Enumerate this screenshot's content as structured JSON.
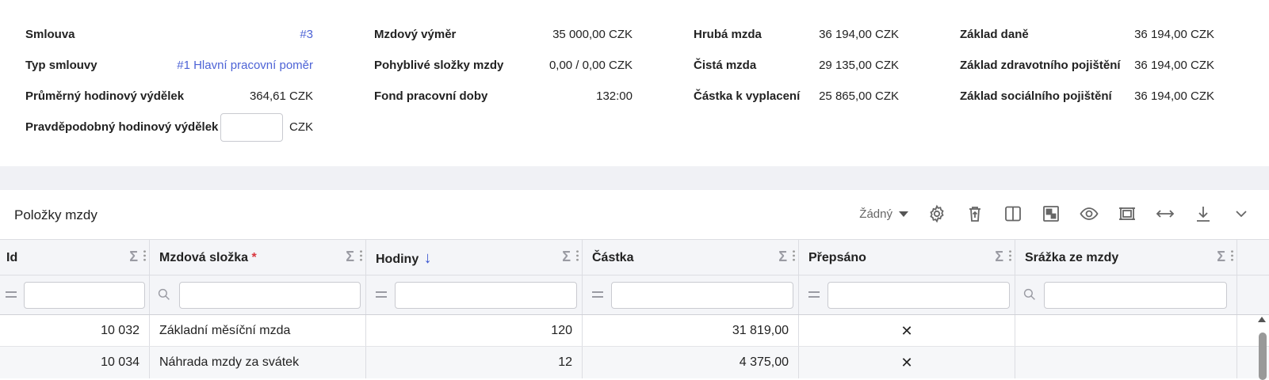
{
  "summary": {
    "col1": [
      {
        "label": "Smlouva",
        "value": "#3"
      },
      {
        "label": "Typ smlouvy",
        "value": "#1 Hlavní pracovní poměr"
      },
      {
        "label": "Průměrný hodinový výdělek",
        "value": "364,61 CZK"
      },
      {
        "label": "Pravděpodobný hodinový výdělek",
        "value": "",
        "unit": "CZK"
      }
    ],
    "col2": [
      {
        "label": "Mzdový výměr",
        "value": "35 000,00 CZK"
      },
      {
        "label": "Pohyblivé složky mzdy",
        "value": "0,00 / 0,00 CZK"
      },
      {
        "label": "Fond pracovní doby",
        "value": "132:00"
      }
    ],
    "col3": [
      {
        "label": "Hrubá mzda",
        "value": "36 194,00 CZK"
      },
      {
        "label": "Čistá mzda",
        "value": "29 135,00 CZK"
      },
      {
        "label": "Částka k vyplacení",
        "value": "25 865,00 CZK"
      }
    ],
    "col4": [
      {
        "label": "Základ daně",
        "value": "36 194,00 CZK"
      },
      {
        "label": "Základ zdravotního pojištění",
        "value": "36 194,00 CZK"
      },
      {
        "label": "Základ sociálního pojištění",
        "value": "36 194,00 CZK"
      }
    ]
  },
  "panel": {
    "title": "Položky mzdy",
    "group_select": "Žádný"
  },
  "grid": {
    "columns": [
      "Id",
      "Mzdová složka",
      "Hodiny",
      "Částka",
      "Přepsáno",
      "Srážka ze mzdy"
    ],
    "required_mark": "*",
    "sort_arrow": "↓",
    "sigma": "Σ",
    "rows": [
      {
        "id": "10 032",
        "component": "Základní měsíční mzda",
        "hours": "120",
        "amount": "31 819,00",
        "overridden": "✕",
        "deduction": ""
      },
      {
        "id": "10 034",
        "component": "Náhrada mzdy za svátek",
        "hours": "12",
        "amount": "4 375,00",
        "overridden": "✕",
        "deduction": ""
      }
    ]
  },
  "colors": {
    "accent": "#4d63d6",
    "required": "#d9363e",
    "sort_arrow": "#3a55d0"
  }
}
